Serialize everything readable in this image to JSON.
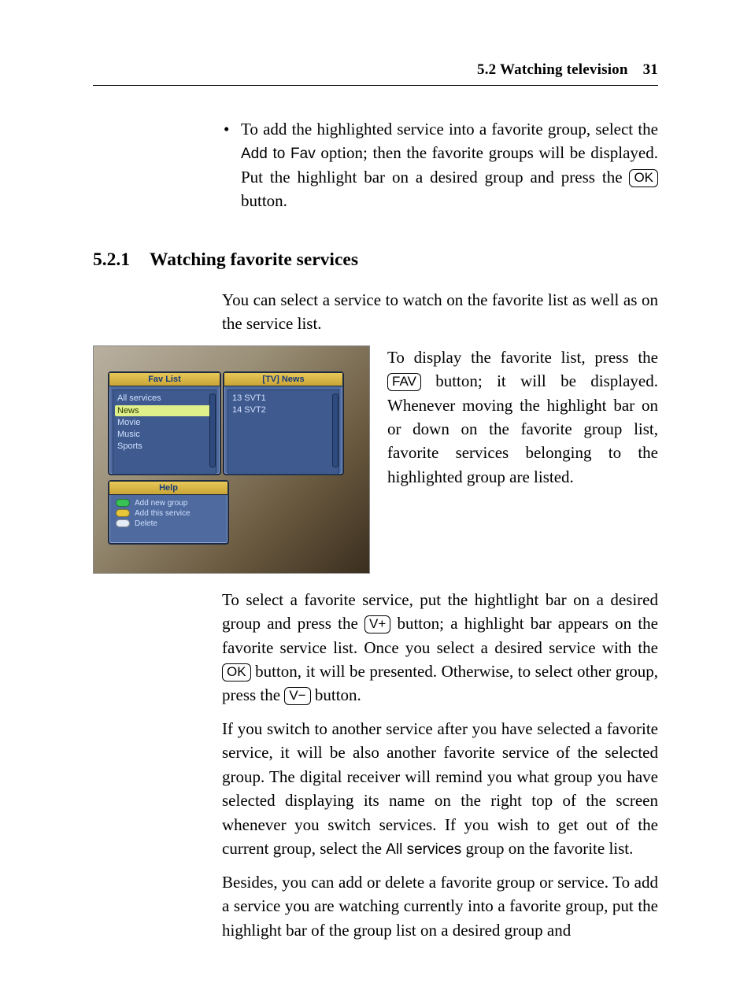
{
  "header": {
    "section": "5.2 Watching television",
    "page": "31"
  },
  "bullet": {
    "pre": "To add the highlighted service into a favorite group, select the ",
    "opt": "Add to Fav",
    "mid": " option; then the favorite groups will be displayed. Put the highlight bar on a desired group and press the ",
    "key": "OK",
    "post": " button."
  },
  "section": {
    "num": "5.2.1",
    "title": "Watching favorite services"
  },
  "intro": "You can select a service to watch on the favorite list as well as on the service list.",
  "aside": {
    "pre": "To display the favorite list, press the ",
    "key": "FAV",
    "post": " button; it will be displayed. Whenever moving the highlight bar on or down on the favorite group list, favorite services belonging to the highlighted group are listed."
  },
  "screenshot": {
    "fav_title": "Fav List",
    "tv_title": "[TV] News",
    "groups": [
      "All services",
      "News",
      "Movie",
      "Music",
      "Sports"
    ],
    "selected_group_index": 1,
    "services": [
      "13  SVT1",
      "14  SVT2"
    ],
    "help_title": "Help",
    "help_items": [
      {
        "color": "green",
        "label": "Add new group"
      },
      {
        "color": "yellow",
        "label": "Add this service"
      },
      {
        "color": "white",
        "label": "Delete"
      }
    ]
  },
  "p1": {
    "a": "To select a favorite service, put the hightlight bar on a desired group and press the ",
    "k1": "V+",
    "b": " button; a highlight bar appears on the favorite service list. Once you select a desired service with the ",
    "k2": "OK",
    "c": " button, it will be presented. Otherwise, to select other group, press the ",
    "k3": "V−",
    "d": " button."
  },
  "p2": {
    "a": "If you switch to another service after you have selected a favorite service, it will be also another favorite service of the selected group. The digital receiver will remind you what group you have selected displaying its name on the right top of the screen whenever you switch services. If you wish to get out of the current group, select the ",
    "svc": "All services",
    "b": " group on the favorite list."
  },
  "p3": "Besides, you can add or delete a favorite group or service.   To add a service you are watching currently into a favorite group, put the highlight bar of the group list on a desired group and"
}
